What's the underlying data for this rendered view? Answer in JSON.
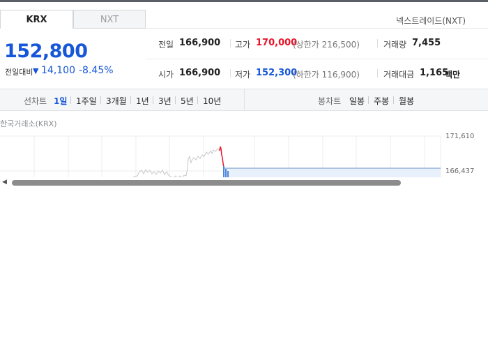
{
  "tabs": [
    {
      "label": "KRX",
      "active": true
    },
    {
      "label": "NXT",
      "active": false
    }
  ],
  "nxt_link": "넥스트레이드(NXT)",
  "price": {
    "current": "152,800",
    "change_label": "전일대비",
    "change_direction": "down",
    "change_amount": "14,100",
    "change_percent": "-8.45%"
  },
  "stats": {
    "prev_close": {
      "label": "전일",
      "value": "166,900"
    },
    "high": {
      "label": "고가",
      "value": "170,000",
      "sub": "(상한가 216,500)"
    },
    "volume": {
      "label": "거래량",
      "value": "7,455"
    },
    "open": {
      "label": "시가",
      "value": "166,900"
    },
    "low": {
      "label": "저가",
      "value": "152,300",
      "sub": "(하한가 116,900)"
    },
    "amount": {
      "label": "거래대금",
      "value": "1,165",
      "unit": "백만"
    }
  },
  "period_bar": {
    "line_label": "선차트",
    "line_options": [
      "1일",
      "1주일",
      "3개월",
      "1년",
      "3년",
      "5년",
      "10년"
    ],
    "active_option": "1일",
    "candle_label": "봉차트",
    "candle_options": [
      "일봉",
      "주봉",
      "월봉"
    ]
  },
  "exchange_label": "한국거래소(KRX)",
  "chart_data": {
    "type": "line",
    "y_ticks": [
      "171,610",
      "166,437"
    ],
    "reference_line": 166437,
    "grid": true
  },
  "colors": {
    "up": "#e8142a",
    "down": "#1656d8",
    "accent": "#1656d8",
    "scroll_thumb": "#8c8c8c"
  },
  "icons": {
    "change_arrow": "triangle-down-icon",
    "scroll_left": "chevron-left-icon"
  }
}
